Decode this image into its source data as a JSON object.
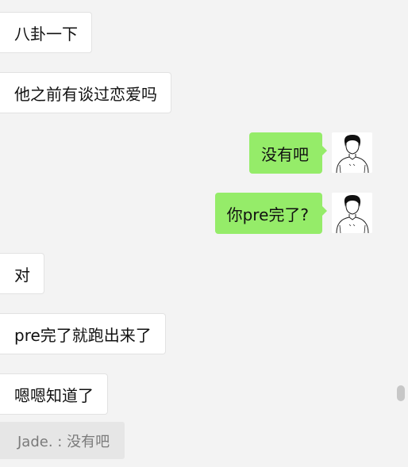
{
  "chat": {
    "messages": [
      {
        "side": "left",
        "text": "八卦一下"
      },
      {
        "side": "left",
        "text": "他之前有谈过恋爱吗"
      },
      {
        "side": "right",
        "text": "没有吧",
        "avatar": "boy-sketch-avatar"
      },
      {
        "side": "right",
        "text": "你pre完了?",
        "avatar": "boy-sketch-avatar"
      },
      {
        "side": "left",
        "text": "对"
      },
      {
        "side": "left",
        "text": "pre完了就跑出来了"
      },
      {
        "side": "left",
        "text": "嗯嗯知道了"
      }
    ],
    "quote": {
      "text": "Jade. : 没有吧"
    }
  },
  "colors": {
    "background": "#f3f3f3",
    "incoming_bubble": "#ffffff",
    "outgoing_bubble": "#95ec69",
    "quote_background": "#e6e6e6",
    "quote_text": "#7a7a7a"
  }
}
